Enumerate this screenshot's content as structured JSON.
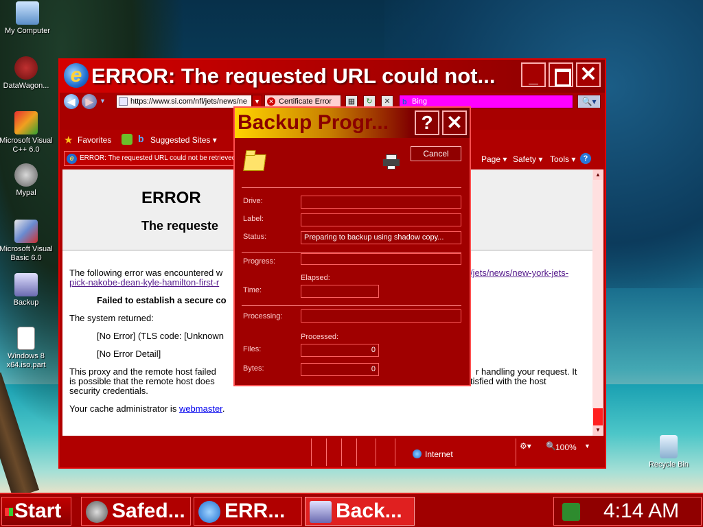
{
  "desktop": {
    "icons": [
      {
        "label": "My Computer"
      },
      {
        "label": "DataWagon..."
      },
      {
        "label": "Microsoft Visual C++ 6.0"
      },
      {
        "label": "Mypal"
      },
      {
        "label": "Microsoft Visual Basic 6.0"
      },
      {
        "label": "Backup"
      },
      {
        "label": "Windows 8 x64.iso.part"
      },
      {
        "label": "Recycle Bin"
      }
    ]
  },
  "browser": {
    "title": "ERROR: The requested URL could not...",
    "address": "https://www.si.com/nfl/jets/news/ne",
    "cert_label": "Certificate Error",
    "search_placeholder": "Bing",
    "favorites": {
      "favorites_label": "Favorites",
      "suggested_label": "Suggested Sites ▾"
    },
    "tab_label": "ERROR: The requested URL could not be retrieved",
    "commands": [
      "Page ▾",
      "Safety ▾",
      "Tools ▾"
    ],
    "page": {
      "heading": "ERROR",
      "subheading": "The requeste",
      "line1_prefix": "The following error was encountered w",
      "line1_link": "/jets/news/new-york-jets-",
      "line2_link": "pick-nakobe-dean-kyle-hamilton-first-r",
      "bold_line": "Failed to establish a secure co",
      "system_returned": "The system returned:",
      "no_error": "[No Error] (TLS code: [Unknown",
      "no_error_detail": "[No Error Detail]",
      "para1a": "This proxy and the remote host failed",
      "para1a_right": "r handling your request. It",
      "para1b": "is possible that the remote host does",
      "para1b_right": "tisfied with the host",
      "para1c": "security credentials.",
      "cache_prefix": "Your cache administrator is ",
      "cache_link": "webmaster",
      "cache_suffix": "."
    },
    "status": {
      "zone": "Internet",
      "zoom": "100%"
    }
  },
  "dialog": {
    "title": "Backup Progr...",
    "help_label": "?",
    "close_label": "✕",
    "cancel_label": "Cancel",
    "fields": {
      "drive_label": "Drive:",
      "drive_value": "",
      "label_label": "Label:",
      "label_value": "",
      "status_label": "Status:",
      "status_value": "Preparing to backup using shadow copy...",
      "progress_label": "Progress:",
      "elapsed_caption": "Elapsed:",
      "time_label": "Time:",
      "time_value": "",
      "processing_label": "Processing:",
      "processing_value": "",
      "processed_caption": "Processed:",
      "files_label": "Files:",
      "files_value": "0",
      "bytes_label": "Bytes:",
      "bytes_value": "0"
    }
  },
  "taskbar": {
    "start_label": "Start",
    "buttons": [
      {
        "label": "Safed..."
      },
      {
        "label": "ERR..."
      },
      {
        "label": "Back..."
      }
    ],
    "clock": "4:14 AM"
  }
}
